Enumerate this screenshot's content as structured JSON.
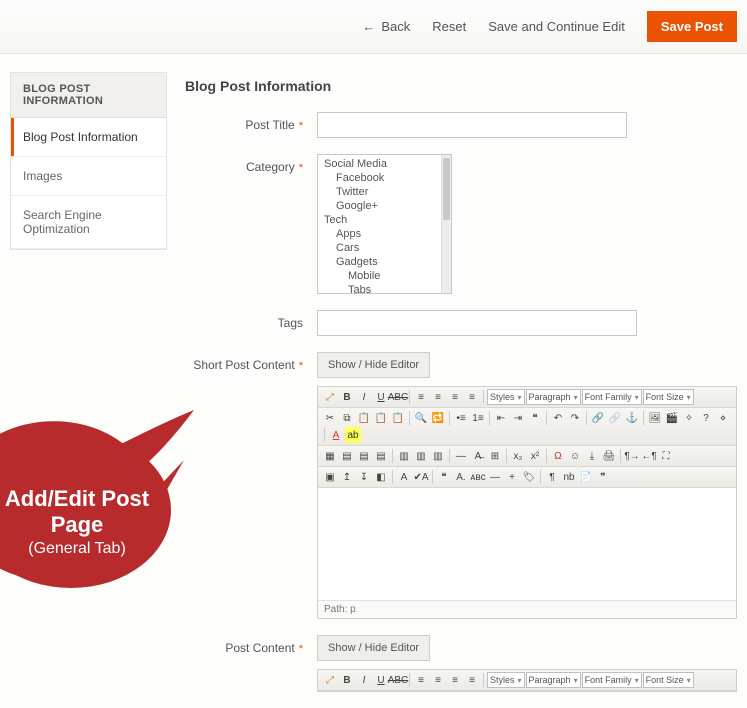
{
  "actions": {
    "back": "Back",
    "reset": "Reset",
    "save_continue": "Save and Continue Edit",
    "save": "Save Post"
  },
  "sidebar": {
    "heading": "BLOG POST INFORMATION",
    "items": [
      {
        "label": "Blog Post Information",
        "active": true
      },
      {
        "label": "Images",
        "active": false
      },
      {
        "label": "Search Engine Optimization",
        "active": false
      }
    ]
  },
  "form": {
    "section_title": "Blog Post Information",
    "post_title": {
      "label": "Post Title",
      "value": ""
    },
    "category": {
      "label": "Category",
      "options": [
        {
          "label": "Social Media",
          "indent": 0
        },
        {
          "label": "Facebook",
          "indent": 1
        },
        {
          "label": "Twitter",
          "indent": 1
        },
        {
          "label": "Google+",
          "indent": 1
        },
        {
          "label": "Tech",
          "indent": 0
        },
        {
          "label": "Apps",
          "indent": 1
        },
        {
          "label": "Cars",
          "indent": 1
        },
        {
          "label": "Gadgets",
          "indent": 1
        },
        {
          "label": "Mobile",
          "indent": 2
        },
        {
          "label": "Tabs",
          "indent": 2
        }
      ]
    },
    "tags": {
      "label": "Tags",
      "value": ""
    },
    "short_content": {
      "label": "Short Post Content",
      "toggle": "Show / Hide Editor",
      "path": "Path: p"
    },
    "content": {
      "label": "Post Content",
      "toggle": "Show / Hide Editor"
    }
  },
  "editor_selects": {
    "styles": "Styles",
    "paragraph": "Paragraph",
    "fontfamily": "Font Family",
    "fontsize": "Font Size"
  },
  "annotation": {
    "line1": "Add/Edit Post Page",
    "line2": "(General Tab)"
  }
}
